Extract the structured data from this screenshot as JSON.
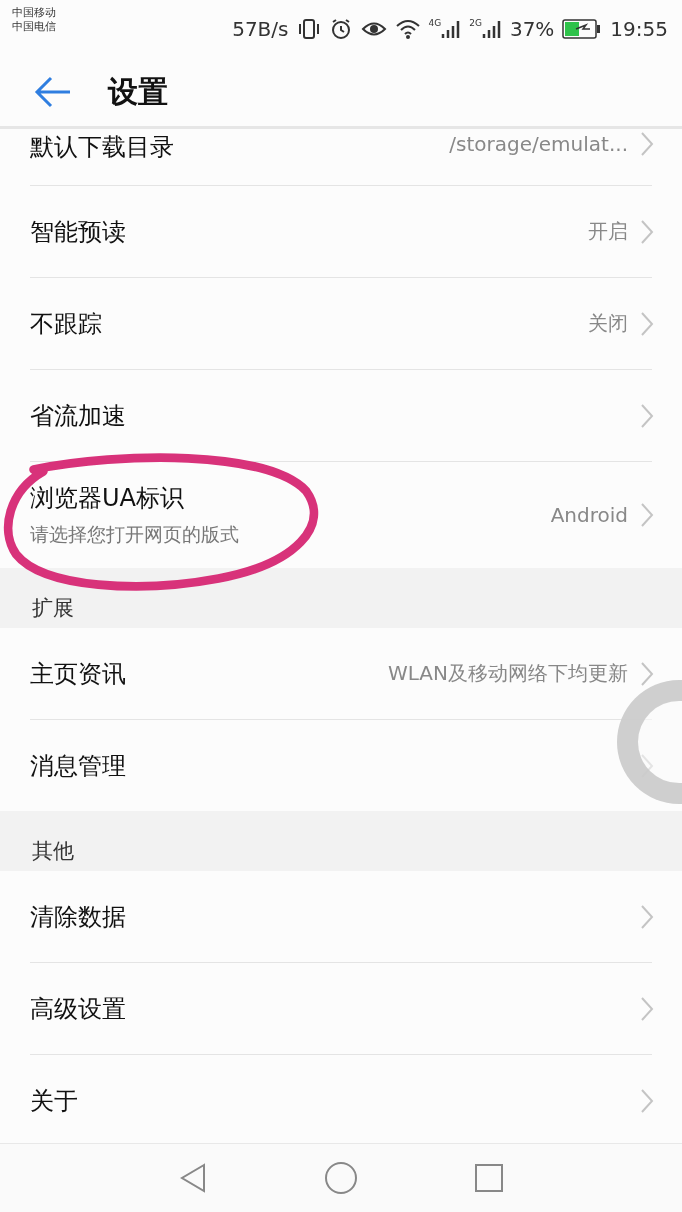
{
  "status_bar": {
    "carriers": [
      "中国移动",
      "中国电信"
    ],
    "speed": "57B/s",
    "network_1": "4G",
    "network_2": "2G",
    "battery": "37%",
    "time": "19:55"
  },
  "header": {
    "title": "设置"
  },
  "groups": [
    {
      "items": [
        {
          "label": "默认下载目录",
          "value": "/storage/emulat..."
        },
        {
          "label": "智能预读",
          "value": "开启"
        },
        {
          "label": "不跟踪",
          "value": "关闭"
        },
        {
          "label": "省流加速"
        },
        {
          "label": "浏览器UA标识",
          "subtitle": "请选择您打开网页的版式",
          "value": "Android"
        }
      ]
    },
    {
      "title": "扩展",
      "items": [
        {
          "label": "主页资讯",
          "value": "WLAN及移动网络下均更新"
        },
        {
          "label": "消息管理"
        }
      ]
    },
    {
      "title": "其他",
      "items": [
        {
          "label": "清除数据"
        },
        {
          "label": "高级设置"
        },
        {
          "label": "关于"
        }
      ]
    }
  ]
}
